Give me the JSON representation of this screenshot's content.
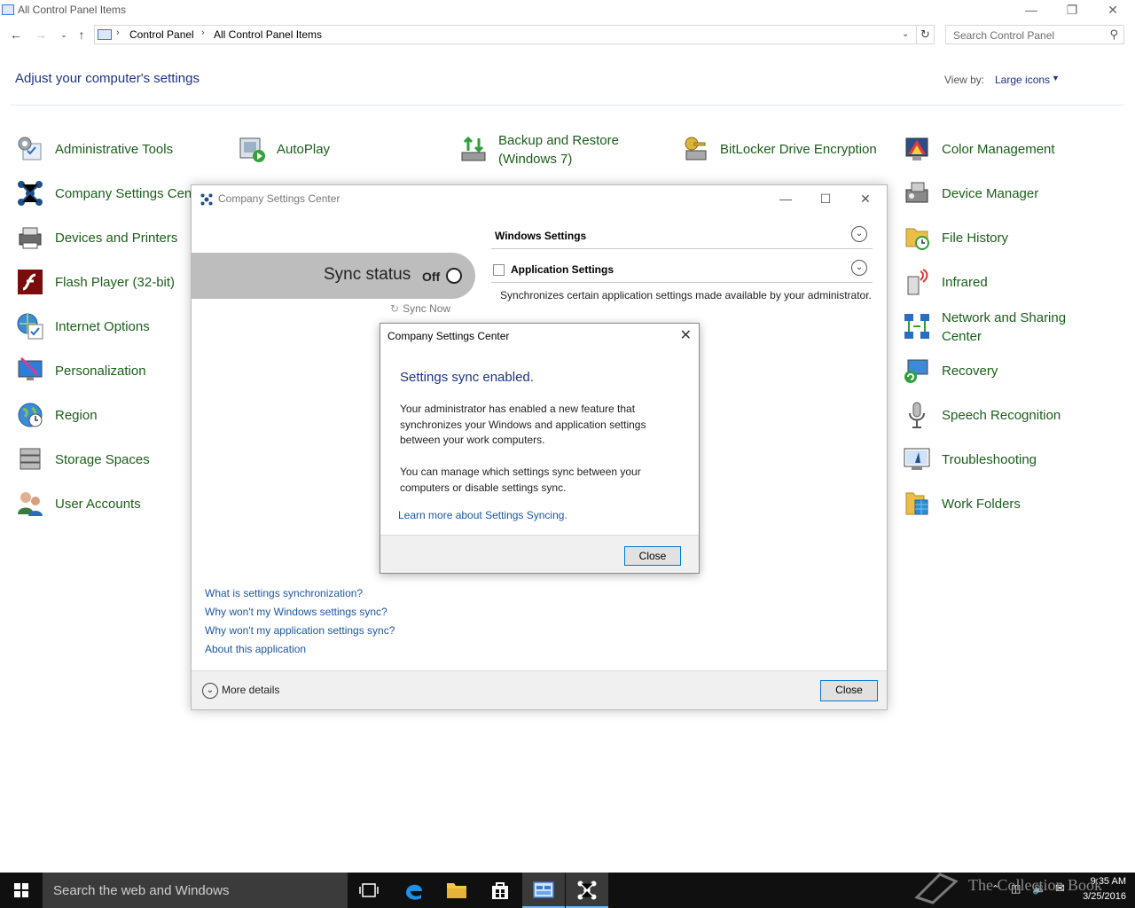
{
  "explorer": {
    "title": "All Control Panel Items",
    "breadcrumb": [
      "Control Panel",
      "All Control Panel Items"
    ],
    "search_placeholder": "Search Control Panel",
    "heading": "Adjust your computer's settings",
    "view_by_label": "View by:",
    "view_by_value": "Large icons",
    "items": [
      {
        "label": "Administrative Tools",
        "icon": "admin-tools-icon"
      },
      {
        "label": "AutoPlay",
        "icon": "autoplay-icon"
      },
      {
        "label": "Backup and Restore (Windows 7)",
        "icon": "backup-icon"
      },
      {
        "label": "BitLocker Drive Encryption",
        "icon": "bitlocker-icon"
      },
      {
        "label": "Color Management",
        "icon": "color-management-icon"
      },
      {
        "label": "Company Settings Center",
        "icon": "company-settings-icon"
      },
      {
        "label": "Device Manager",
        "icon": "device-manager-icon"
      },
      {
        "label": "Devices and Printers",
        "icon": "printer-icon"
      },
      {
        "label": "File History",
        "icon": "file-history-icon"
      },
      {
        "label": "Flash Player (32-bit)",
        "icon": "flash-icon"
      },
      {
        "label": "Infrared",
        "icon": "infrared-icon"
      },
      {
        "label": "Internet Options",
        "icon": "internet-options-icon"
      },
      {
        "label": "Network and Sharing Center",
        "icon": "network-icon"
      },
      {
        "label": "Personalization",
        "icon": "personalization-icon"
      },
      {
        "label": "Recovery",
        "icon": "recovery-icon"
      },
      {
        "label": "Region",
        "icon": "region-icon"
      },
      {
        "label": "Speech Recognition",
        "icon": "microphone-icon"
      },
      {
        "label": "Storage Spaces",
        "icon": "storage-icon"
      },
      {
        "label": "Troubleshooting",
        "icon": "troubleshooting-icon"
      },
      {
        "label": "User Accounts",
        "icon": "user-accounts-icon"
      },
      {
        "label": "Work Folders",
        "icon": "work-folders-icon"
      }
    ]
  },
  "csc": {
    "title": "Company Settings Center",
    "sync_status_label": "Sync status",
    "sync_status_value": "Off",
    "sync_now": "Sync Now",
    "windows_settings": "Windows Settings",
    "application_settings": "Application Settings",
    "app_settings_desc": "Synchronizes certain application settings made available by your administrator.",
    "links": [
      "What is settings synchronization?",
      "Why won't my Windows settings sync?",
      "Why won't my application settings sync?",
      "About this application"
    ],
    "more_details": "More details",
    "close": "Close"
  },
  "dialog": {
    "title": "Company Settings Center",
    "heading": "Settings sync enabled.",
    "para1": "Your administrator has enabled a new feature that synchronizes your Windows and application settings between your work computers.",
    "para2": "You can manage which settings sync between your computers or disable settings sync.",
    "link": "Learn more about Settings Syncing.",
    "close": "Close"
  },
  "taskbar": {
    "search_placeholder": "Search the web and Windows",
    "time": "9:35 AM",
    "date": "3/25/2016",
    "watermark": "The Collection Book"
  },
  "colors": {
    "link_blue": "#1c57a5",
    "heading_blue": "#1e3287",
    "item_green": "#1a5e1a",
    "taskbar": "#101010"
  }
}
